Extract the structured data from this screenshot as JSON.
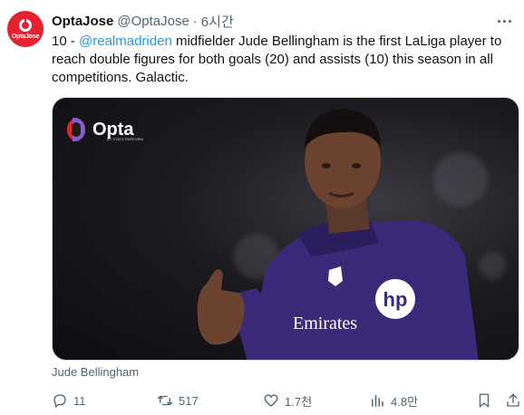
{
  "author": {
    "display_name": "OptaJose",
    "handle": "@OptaJose",
    "separator": "·",
    "time": "6시간",
    "avatar_text": "OptaJose"
  },
  "tweet": {
    "text_before": "10 - ",
    "mention": "@realmadriden",
    "text_after": " midfielder Jude Bellingham is the first LaLiga player to reach double figures for both goals (20) and assists (10) this season in all competitions. Galactic."
  },
  "media": {
    "logo_text": "Opta",
    "logo_sub": "BY STATS PERFORM",
    "shirt_text": "Emirates",
    "sponsor_text": "hp",
    "caption": "Jude Bellingham"
  },
  "actions": {
    "replies": "11",
    "reposts": "517",
    "likes": "1.7천",
    "views": "4.8만"
  },
  "colors": {
    "accent": "#1d9bf0",
    "secondary_text": "#536471",
    "opta_red": "#e8202f",
    "opta_purple": "#8a5cc8",
    "kit_purple": "#3b2a7a"
  }
}
